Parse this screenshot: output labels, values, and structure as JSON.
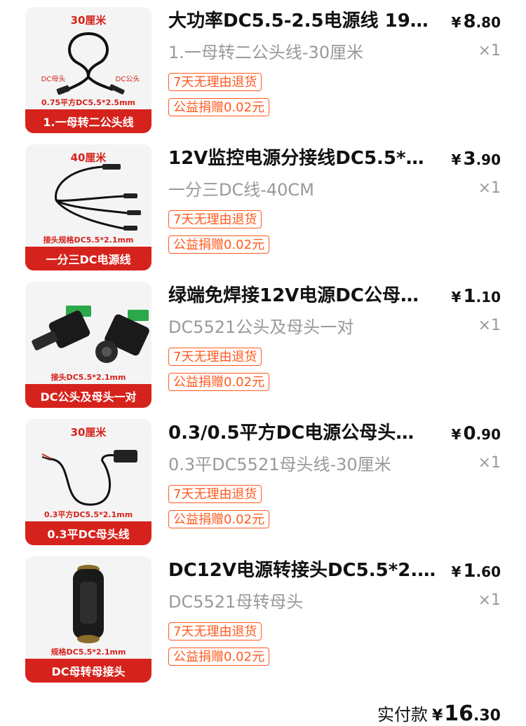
{
  "items": [
    {
      "image": {
        "top_label": "30厘米",
        "label_left": "DC母头",
        "label_right": "DC公头",
        "spec_text": "0.75平方DC5.5*2.5mm",
        "banner": "1.一母转二公头线"
      },
      "title": "大功率DC5.5-2.5电源线 19…",
      "price": {
        "currency": "¥",
        "int": "8",
        "dec": ".80"
      },
      "spec": "1.一母转二公头线-30厘米",
      "qty": "×1",
      "tags": [
        "7天无理由退货",
        "公益捐赠0.02元"
      ]
    },
    {
      "image": {
        "top_label": "40厘米",
        "spec_text": "接头规格DC5.5*2.1mm",
        "banner": "一分三DC电源线"
      },
      "title": "12V监控电源分接线DC5.5*…",
      "price": {
        "currency": "¥",
        "int": "3",
        "dec": ".90"
      },
      "spec": "一分三DC线-40CM",
      "qty": "×1",
      "tags": [
        "7天无理由退货",
        "公益捐赠0.02元"
      ]
    },
    {
      "image": {
        "spec_text": "接头DC5.5*2.1mm",
        "banner": "DC公头及母头一对"
      },
      "title": "绿端免焊接12V电源DC公母…",
      "price": {
        "currency": "¥",
        "int": "1",
        "dec": ".10"
      },
      "spec": "DC5521公头及母头一对",
      "qty": "×1",
      "tags": [
        "7天无理由退货",
        "公益捐赠0.02元"
      ]
    },
    {
      "image": {
        "top_label": "30厘米",
        "spec_text": "0.3平方DC5.5*2.1mm",
        "banner": "0.3平DC母头线"
      },
      "title": "0.3/0.5平方DC电源公母头…",
      "price": {
        "currency": "¥",
        "int": "0",
        "dec": ".90"
      },
      "spec": "0.3平DC5521母头线-30厘米",
      "qty": "×1",
      "tags": [
        "7天无理由退货",
        "公益捐赠0.02元"
      ]
    },
    {
      "image": {
        "spec_text": "规格DC5.5*2.1mm",
        "banner": "DC母转母接头"
      },
      "title": "DC12V电源转接头DC5.5*2.1…",
      "price": {
        "currency": "¥",
        "int": "1",
        "dec": ".60"
      },
      "spec": "DC5521母转母头",
      "qty": "×1",
      "tags": [
        "7天无理由退货",
        "公益捐赠0.02元"
      ]
    }
  ],
  "footer": {
    "label": "实付款",
    "currency": "¥",
    "int": "16",
    "dec": ".30"
  },
  "colors": {
    "accent": "#ff5a1f",
    "banner": "#d6221c",
    "muted": "#999999"
  }
}
